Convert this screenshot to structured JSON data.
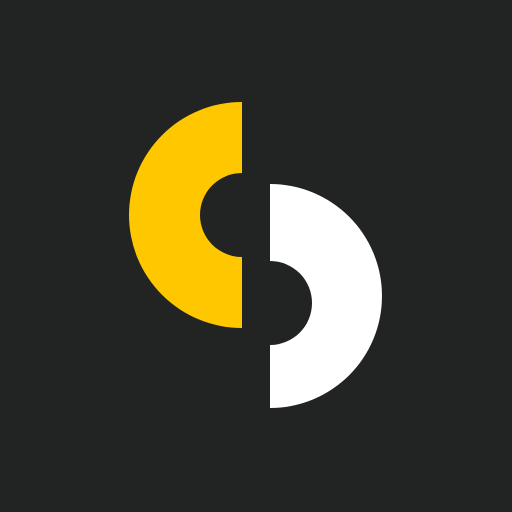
{
  "logo": {
    "icon_name": "split-s-logo-icon",
    "background_color": "#222323",
    "left_half_color": "#FFC700",
    "right_half_color": "#FFFFFF"
  }
}
